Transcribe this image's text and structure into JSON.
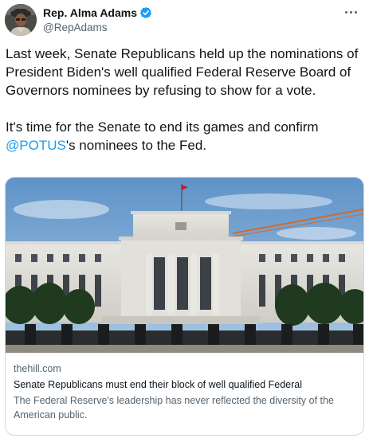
{
  "author": {
    "display_name": "Rep. Alma Adams",
    "handle": "@RepAdams",
    "verified_icon": "verified-badge-icon",
    "avatar_icon": "profile-photo"
  },
  "tweet": {
    "paragraph_1": "Last week, Senate Republicans held up the nominations of President Biden's well qualified Federal Reserve Board of Governors nominees by refusing to show for a vote.",
    "paragraph_2_before": "It's time for the Senate to end its games and confirm ",
    "mention": "@POTUS",
    "paragraph_2_after": "'s nominees to the Fed."
  },
  "card": {
    "domain": "thehill.com",
    "title": "Senate Republicans must end their block of well qualified Federal",
    "description": "The Federal Reserve's leadership has never reflected the diversity of the American public.",
    "image_icon": "federal-reserve-building-photo"
  },
  "colors": {
    "link": "#1d9bf0",
    "secondary_text": "#536471",
    "border": "#cfd9de"
  }
}
